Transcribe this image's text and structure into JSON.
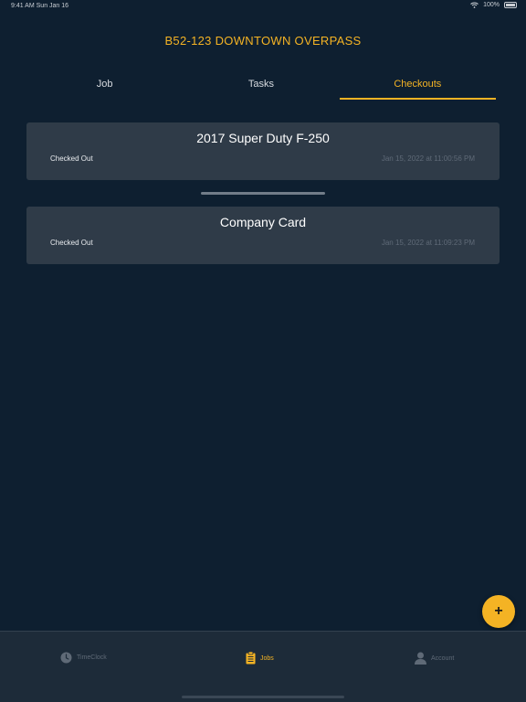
{
  "status_bar": {
    "time": "9:41 AM",
    "date": "Sun Jan 16",
    "battery": "100%"
  },
  "header": {
    "title": "B52-123 DOWNTOWN OVERPASS"
  },
  "tabs": [
    {
      "label": "Job",
      "active": false
    },
    {
      "label": "Tasks",
      "active": false
    },
    {
      "label": "Checkouts",
      "active": true
    }
  ],
  "checkouts": [
    {
      "title": "2017 Super Duty F-250",
      "status": "Checked Out",
      "date": "Jan 15, 2022 at 11:00:56 PM"
    },
    {
      "title": "Company Card",
      "status": "Checked Out",
      "date": "Jan 15, 2022 at 11:09:23 PM"
    }
  ],
  "fab": {
    "label": "+",
    "icon": "plus-icon"
  },
  "tabbar": [
    {
      "label": "TimeClock",
      "icon": "clock-icon",
      "active": false
    },
    {
      "label": "Jobs",
      "icon": "clipboard-icon",
      "active": true
    },
    {
      "label": "Account",
      "icon": "person-icon",
      "active": false
    }
  ],
  "colors": {
    "background": "#0e1f30",
    "accent": "#f4b324",
    "card": "#2f3b48",
    "tabbar": "#1d2b39",
    "muted": "#5f6a77"
  }
}
